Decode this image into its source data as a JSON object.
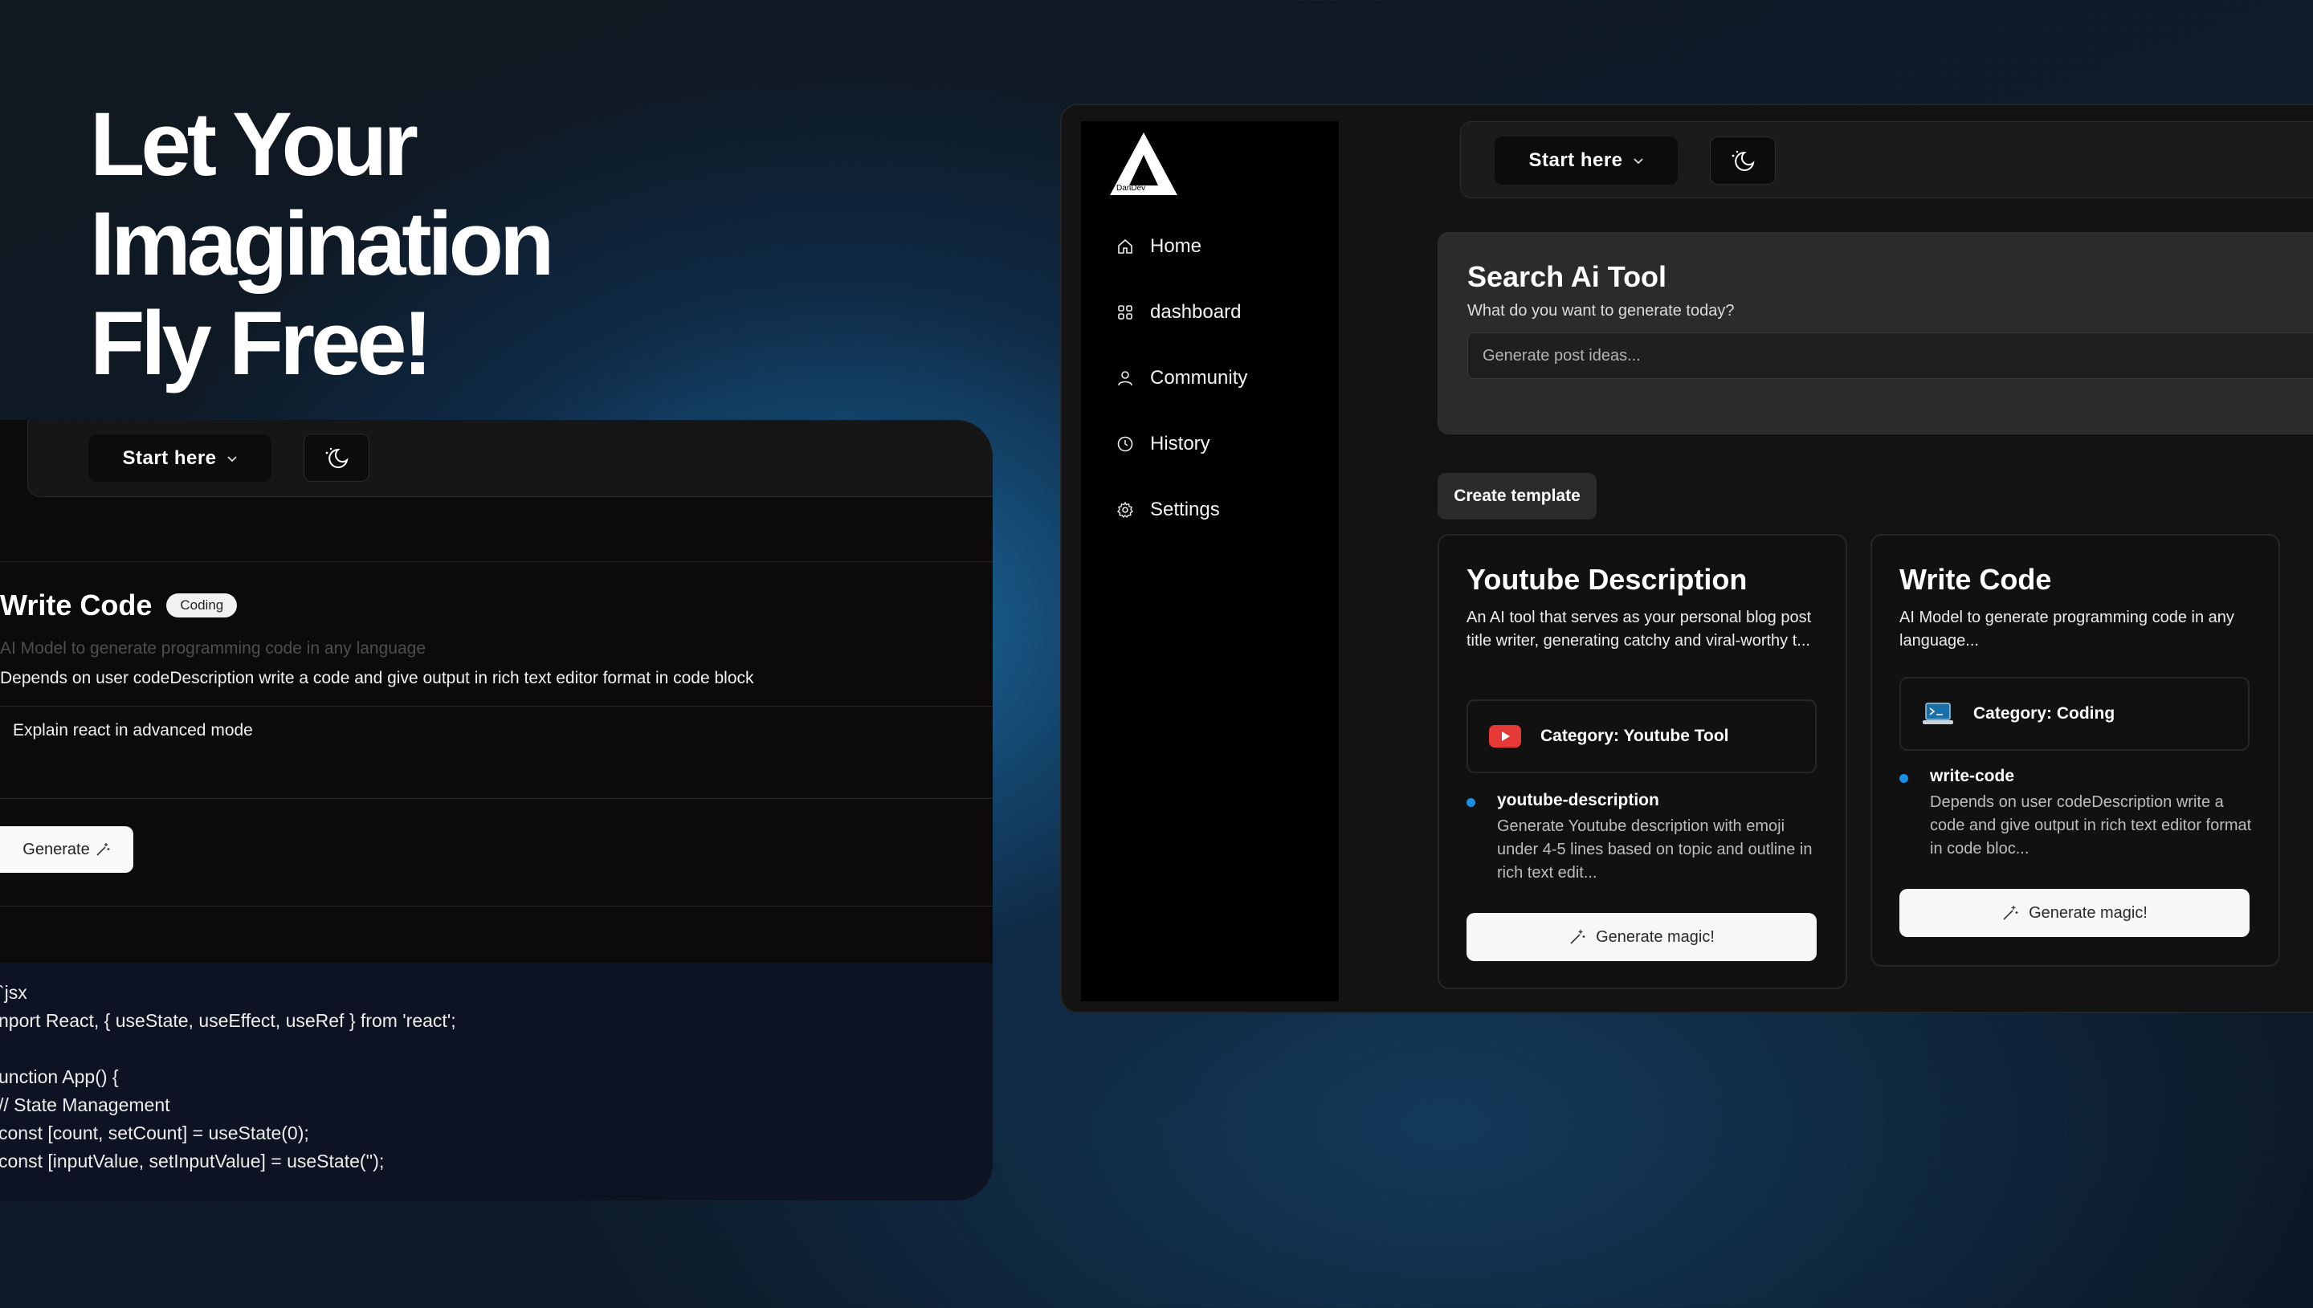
{
  "hero": {
    "line1": "Let Your Imagination",
    "line2": "Fly Free!"
  },
  "left_panel": {
    "start_label": "Start here",
    "tool_title": "Write Code",
    "badge": "Coding",
    "description": "AI Model to generate programming code in any language",
    "prompt": "Depends on user codeDescription write a code and give output in rich text editor format in code block",
    "input_value": "Explain react in advanced mode",
    "generate_label": "Generate",
    "code_lines": [
      "`jsx",
      "nport React, { useState, useEffect, useRef } from 'react';",
      "",
      "unction App() {",
      "// State Management",
      "const [count, setCount] = useState(0);",
      "const [inputValue, setInputValue] = useState('');"
    ]
  },
  "app": {
    "logo_text": "DanDev",
    "sidebar": {
      "items": [
        {
          "label": "Home",
          "icon": "home-icon"
        },
        {
          "label": "dashboard",
          "icon": "grid-icon"
        },
        {
          "label": "Community",
          "icon": "user-icon"
        },
        {
          "label": "History",
          "icon": "clock-icon"
        },
        {
          "label": "Settings",
          "icon": "gear-icon"
        }
      ]
    },
    "topbar": {
      "start_label": "Start here"
    },
    "search": {
      "title": "Search Ai Tool",
      "subtitle": "What do you want to generate today?",
      "placeholder": "Generate post ideas..."
    },
    "create_template": "Create template",
    "cards": [
      {
        "title": "Youtube Description",
        "description": "An AI tool that serves as your personal blog post title writer, generating catchy and viral-worthy t...",
        "category": "Category: Youtube Tool",
        "slug": "youtube-description",
        "slug_desc": "Generate Youtube description with emoji under 4-5 lines based on topic and outline in rich text edit...",
        "button": "Generate magic!"
      },
      {
        "title": "Write Code",
        "description": "AI Model to generate programming code in any language...",
        "category": "Category: Coding",
        "slug": "write-code",
        "slug_desc": "Depends on user codeDescription write a code and give output in rich text editor format in code bloc...",
        "button": "Generate magic!"
      }
    ]
  },
  "colors": {
    "accent_dot": "#1a8fe3",
    "youtube_red": "#e53935"
  }
}
